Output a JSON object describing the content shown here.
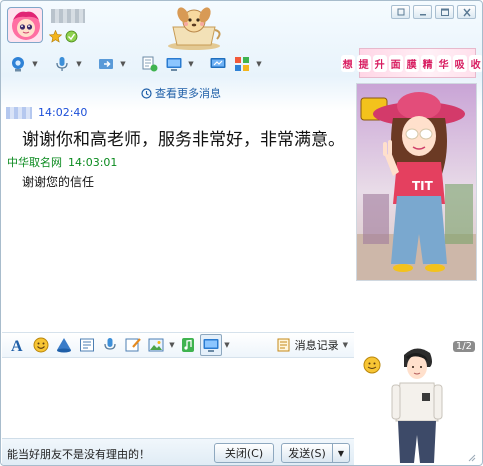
{
  "window": {
    "controls": [
      "restore-icon",
      "minimize-icon",
      "maximize-icon",
      "close-icon"
    ]
  },
  "toolbar": {
    "icons": [
      "video-call-icon",
      "voice-call-icon",
      "file-transfer-icon",
      "remote-assist-icon",
      "screen-share-icon",
      "app-box-icon"
    ]
  },
  "ad": {
    "chars": [
      "想",
      "提",
      "升",
      "面",
      "膜",
      "精",
      "华",
      "吸",
      "收",
      "?"
    ]
  },
  "chat": {
    "more_messages": "查看更多消息",
    "messages": [
      {
        "time": "14:02:40",
        "text": "谢谢你和高老师，服务非常好，非常满意。"
      },
      {
        "sender": "中华取名网",
        "time": "14:03:01",
        "text": "谢谢您的信任"
      }
    ]
  },
  "input_toolbar": {
    "icons": [
      "font-icon",
      "emoji-icon",
      "shake-icon",
      "magic-text-icon",
      "voice-message-icon",
      "graffiti-icon",
      "image-icon",
      "music-icon",
      "screenshot-icon"
    ],
    "history_label": "消息记录"
  },
  "footer": {
    "tip": "能当好朋友不是没有理由的！",
    "close_label": "关闭(C)",
    "send_label": "发送(S)"
  },
  "self_panel": {
    "page": "1/2"
  },
  "colors": {
    "time_blue": "#1c4fd8",
    "contact_green": "#0a8a1e",
    "link_blue": "#1f5fa8"
  }
}
